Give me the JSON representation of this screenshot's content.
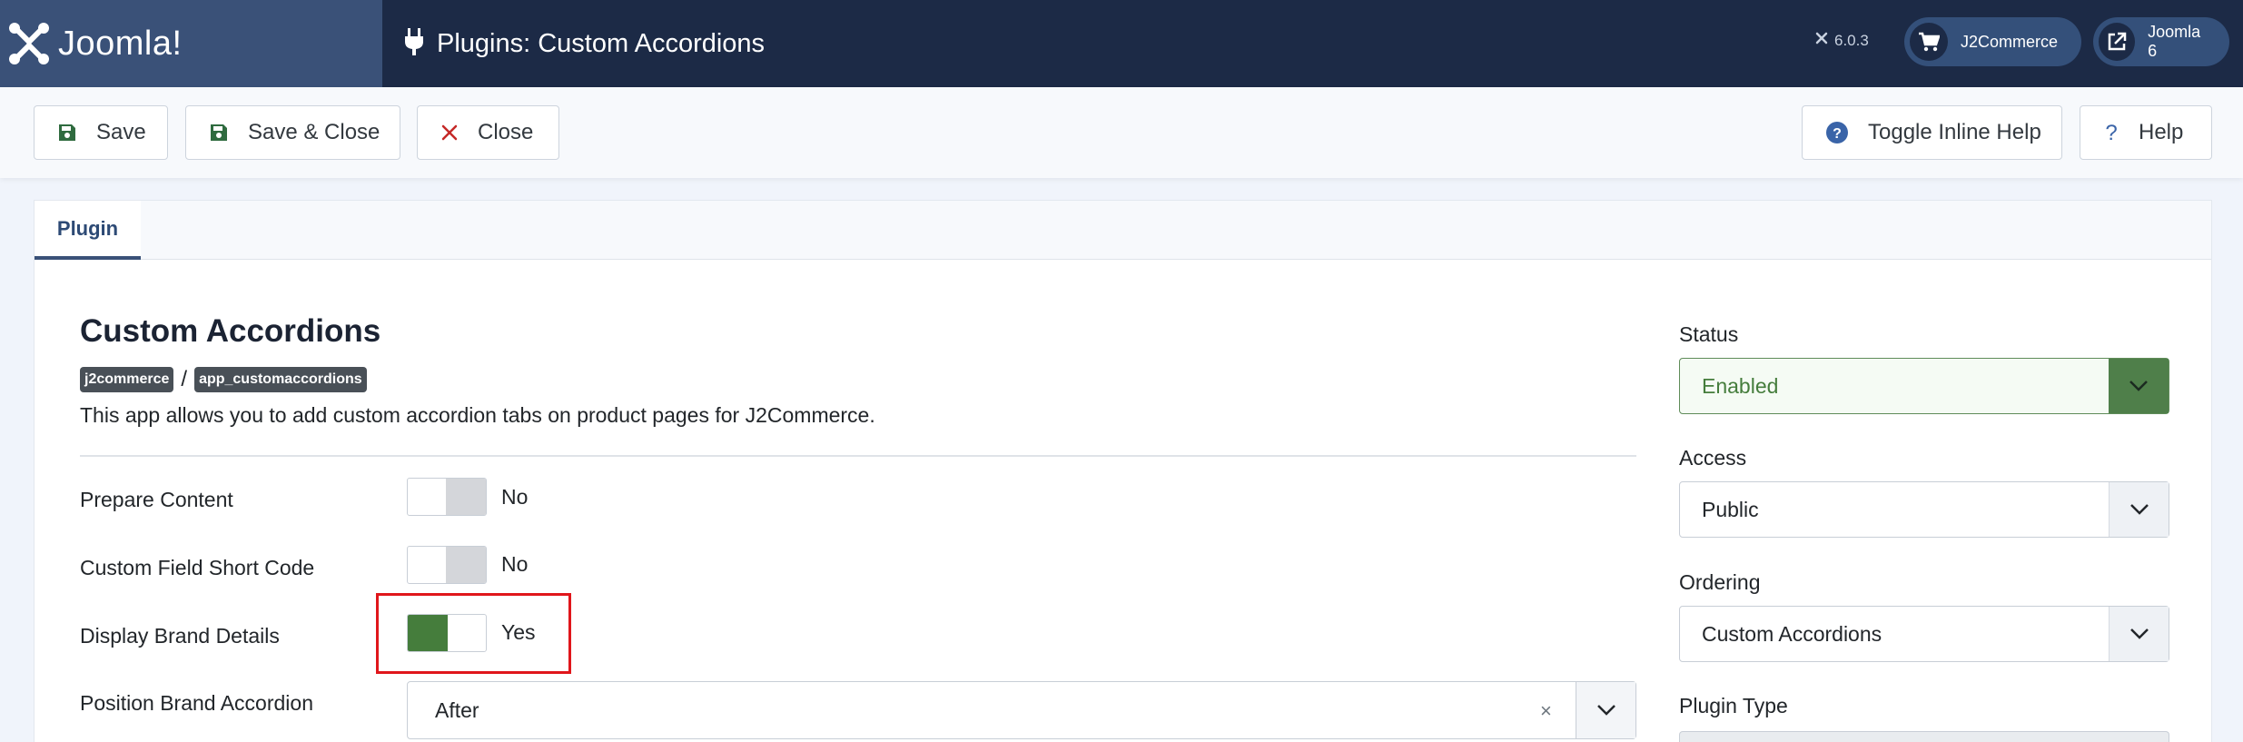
{
  "header": {
    "brand": "Joomla!",
    "page_title": "Plugins: Custom Accordions",
    "version": "6.0.3",
    "shortcuts": [
      {
        "label": "J2Commerce",
        "icon": "cart-icon"
      },
      {
        "label": "Joomla 6",
        "icon": "external-link-icon"
      }
    ]
  },
  "toolbar": {
    "save_label": "Save",
    "save_close_label": "Save & Close",
    "close_label": "Close",
    "toggle_help_label": "Toggle Inline Help",
    "help_label": "Help"
  },
  "tabs": [
    {
      "label": "Plugin",
      "active": true
    }
  ],
  "plugin": {
    "title": "Custom Accordions",
    "badges": [
      "j2commerce",
      "app_customaccordions"
    ],
    "separator": "/",
    "description": "This app allows you to add custom accordion tabs on product pages for J2Commerce."
  },
  "fields": {
    "prepare_content": {
      "label": "Prepare Content",
      "value": "No"
    },
    "custom_field_short_code": {
      "label": "Custom Field Short Code",
      "value": "No"
    },
    "display_brand_details": {
      "label": "Display Brand Details",
      "value": "Yes"
    },
    "position_brand_accordion": {
      "label": "Position Brand Accordion",
      "value": "After",
      "clear": "×"
    }
  },
  "sidebar": {
    "status": {
      "label": "Status",
      "value": "Enabled"
    },
    "access": {
      "label": "Access",
      "value": "Public"
    },
    "ordering": {
      "label": "Ordering",
      "value": "Custom Accordions"
    },
    "plugin_type": {
      "label": "Plugin Type"
    }
  },
  "colors": {
    "header_bg": "#1c2a46",
    "brand_bg": "#3a5178",
    "toggle_on": "#457d3c",
    "highlight": "#e0161b"
  }
}
